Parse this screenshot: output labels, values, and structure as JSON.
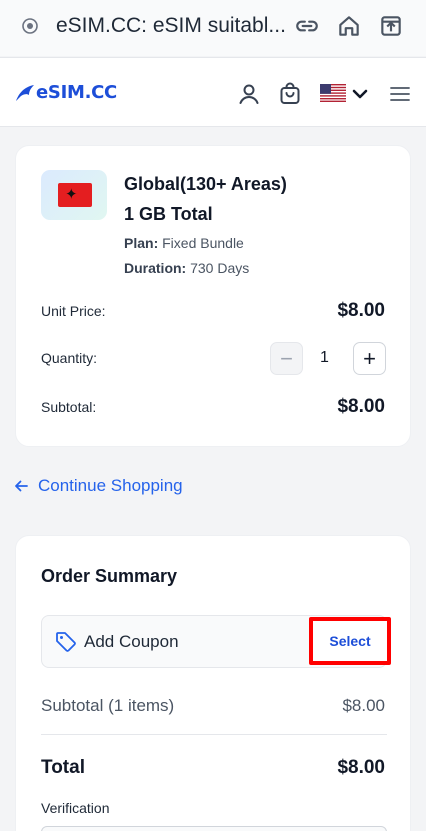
{
  "browser": {
    "title": "eSIM.CC: eSIM suitabl...",
    "icons": [
      "site-info-icon",
      "link-icon",
      "home-icon",
      "share-icon"
    ]
  },
  "header": {
    "logo_text": "eSIM.CC",
    "icons": [
      "user-icon",
      "cart-icon",
      "us-flag-icon",
      "chevron-down-icon",
      "menu-icon"
    ]
  },
  "cart_item": {
    "flag": "albania-flag-icon",
    "title": "Global(130+ Areas)",
    "subtitle": "1 GB Total",
    "plan_label": "Plan:",
    "plan_value": "Fixed Bundle",
    "duration_label": "Duration:",
    "duration_value": "730 Days",
    "unit_price_label": "Unit Price:",
    "unit_price_value": "$8.00",
    "quantity_label": "Quantity:",
    "quantity_minus": "−",
    "quantity_value": "1",
    "quantity_plus": "+",
    "subtotal_label": "Subtotal:",
    "subtotal_value": "$8.00"
  },
  "continue_shopping": "Continue Shopping",
  "order_summary": {
    "title": "Order Summary",
    "coupon_label": "Add Coupon",
    "select_label": "Select",
    "subtotal_label": "Subtotal (1 items)",
    "subtotal_value": "$8.00",
    "total_label": "Total",
    "total_value": "$8.00",
    "verification_label": "Verification"
  },
  "colors": {
    "accent": "#2563eb",
    "highlight_border": "#ff0000"
  }
}
